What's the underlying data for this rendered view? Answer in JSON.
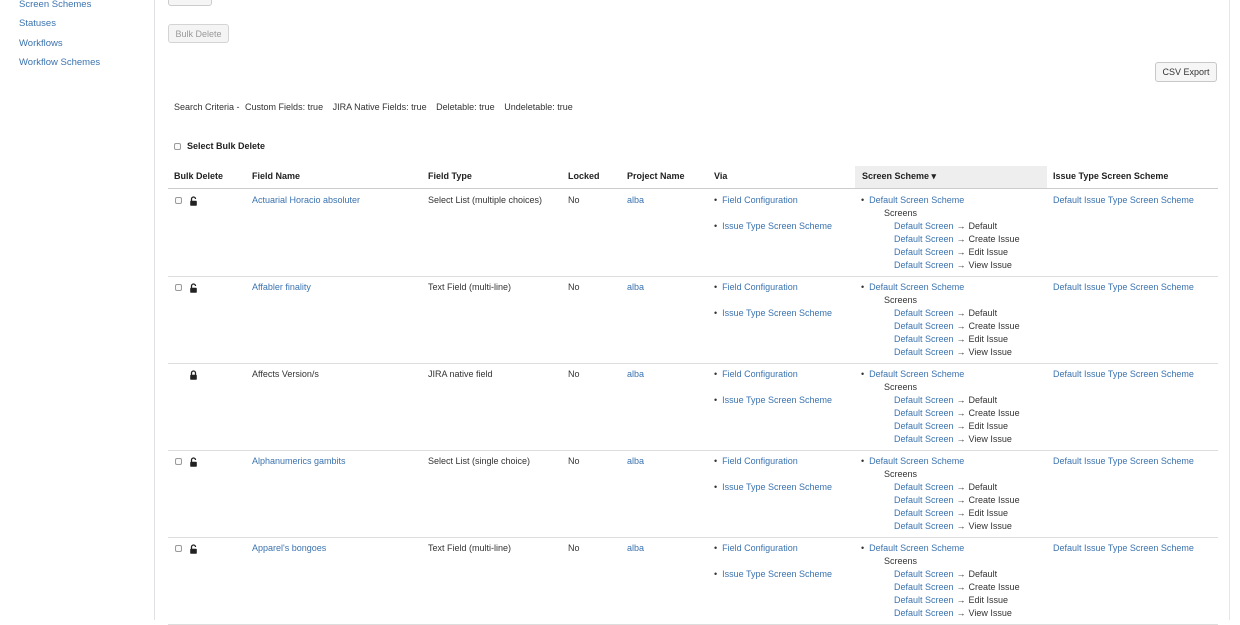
{
  "sidebar": {
    "items": [
      {
        "label": "Screen Schemes"
      },
      {
        "label": "Statuses"
      },
      {
        "label": "Workflows"
      },
      {
        "label": "Workflow Schemes"
      }
    ]
  },
  "toolbar": {
    "bulk_delete_label": "Bulk Delete",
    "csv_export_label": "CSV Export"
  },
  "criteria": {
    "prefix": "Search Criteria -",
    "items": [
      "Custom Fields: true",
      "JIRA Native Fields: true",
      "Deletable: true",
      "Undeletable: true"
    ]
  },
  "select_bulk_delete_label": "Select Bulk Delete",
  "table": {
    "headers": {
      "bulk_delete": "Bulk Delete",
      "field_name": "Field Name",
      "field_type": "Field Type",
      "locked": "Locked",
      "project_name": "Project Name",
      "via": "Via",
      "screen_scheme": "Screen Scheme ▾",
      "issue_type_screen_scheme": "Issue Type Screen Scheme"
    },
    "arrow": "→",
    "rows": [
      {
        "field_name": "Actuarial Horacio absoluter",
        "field_type": "Select List (multiple choices)",
        "locked": "No",
        "project_name": "alba",
        "via": [
          "Field Configuration",
          "Issue Type Screen Scheme"
        ],
        "screen_scheme": "Default Screen Scheme",
        "screens_label": "Screens",
        "screens": [
          {
            "screen": "Default Screen",
            "operation": "Default"
          },
          {
            "screen": "Default Screen",
            "operation": "Create Issue"
          },
          {
            "screen": "Default Screen",
            "operation": "Edit Issue"
          },
          {
            "screen": "Default Screen",
            "operation": "View Issue"
          }
        ],
        "issue_type_screen_scheme": "Default Issue Type Screen Scheme"
      },
      {
        "field_name": "Affabler finality",
        "field_type": "Text Field (multi-line)",
        "locked": "No",
        "project_name": "alba",
        "via": [
          "Field Configuration",
          "Issue Type Screen Scheme"
        ],
        "screen_scheme": "Default Screen Scheme",
        "screens_label": "Screens",
        "screens": [
          {
            "screen": "Default Screen",
            "operation": "Default"
          },
          {
            "screen": "Default Screen",
            "operation": "Create Issue"
          },
          {
            "screen": "Default Screen",
            "operation": "Edit Issue"
          },
          {
            "screen": "Default Screen",
            "operation": "View Issue"
          }
        ],
        "issue_type_screen_scheme": "Default Issue Type Screen Scheme"
      },
      {
        "field_name": "Affects Version/s",
        "field_type": "JIRA native field",
        "locked": "No",
        "project_name": "alba",
        "via": [
          "Field Configuration",
          "Issue Type Screen Scheme"
        ],
        "screen_scheme": "Default Screen Scheme",
        "screens_label": "Screens",
        "screens": [
          {
            "screen": "Default Screen",
            "operation": "Default"
          },
          {
            "screen": "Default Screen",
            "operation": "Create Issue"
          },
          {
            "screen": "Default Screen",
            "operation": "Edit Issue"
          },
          {
            "screen": "Default Screen",
            "operation": "View Issue"
          }
        ],
        "issue_type_screen_scheme": "Default Issue Type Screen Scheme"
      },
      {
        "field_name": "Alphanumerics gambits",
        "field_type": "Select List (single choice)",
        "locked": "No",
        "project_name": "alba",
        "via": [
          "Field Configuration",
          "Issue Type Screen Scheme"
        ],
        "screen_scheme": "Default Screen Scheme",
        "screens_label": "Screens",
        "screens": [
          {
            "screen": "Default Screen",
            "operation": "Default"
          },
          {
            "screen": "Default Screen",
            "operation": "Create Issue"
          },
          {
            "screen": "Default Screen",
            "operation": "Edit Issue"
          },
          {
            "screen": "Default Screen",
            "operation": "View Issue"
          }
        ],
        "issue_type_screen_scheme": "Default Issue Type Screen Scheme"
      },
      {
        "field_name": "Apparel's bongoes",
        "field_type": "Text Field (multi-line)",
        "locked": "No",
        "project_name": "alba",
        "via": [
          "Field Configuration",
          "Issue Type Screen Scheme"
        ],
        "screen_scheme": "Default Screen Scheme",
        "screens_label": "Screens",
        "screens": [
          {
            "screen": "Default Screen",
            "operation": "Default"
          },
          {
            "screen": "Default Screen",
            "operation": "Create Issue"
          },
          {
            "screen": "Default Screen",
            "operation": "Edit Issue"
          },
          {
            "screen": "Default Screen",
            "operation": "View Issue"
          }
        ],
        "issue_type_screen_scheme": "Default Issue Type Screen Scheme"
      }
    ]
  }
}
